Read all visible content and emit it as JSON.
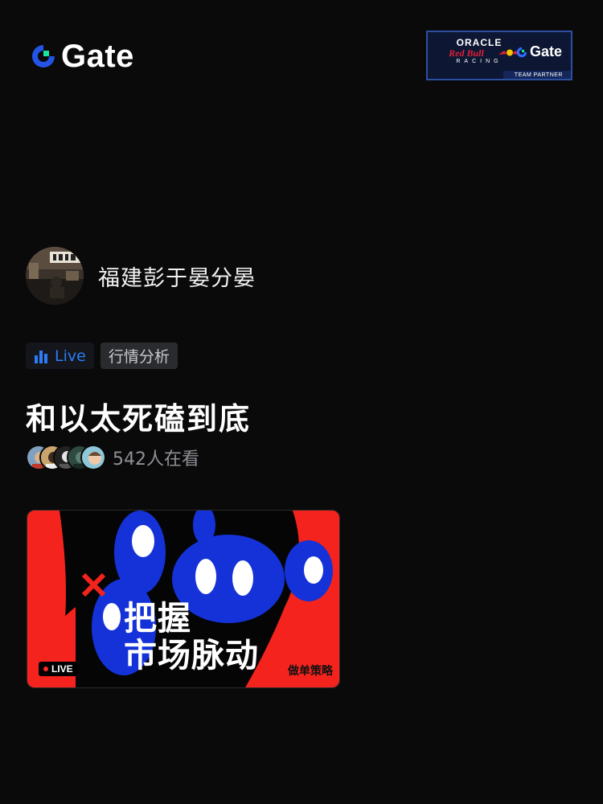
{
  "header": {
    "brand_name": "Gate",
    "brand_icon": "gate-logo-icon",
    "partner": {
      "oracle": "ORACLE",
      "redbull": "Red Bull",
      "racing": "RACING",
      "gate": "Gate",
      "team_partner": "TEAM PARTNER"
    }
  },
  "host": {
    "name": "福建彭于晏分晏",
    "avatar_icon": "host-avatar"
  },
  "tags": {
    "live_label": "Live",
    "topic_label": "行情分析"
  },
  "room": {
    "title": "和以太死磕到底"
  },
  "viewers": {
    "count_text": "542人在看"
  },
  "cover": {
    "headline_line1": "把握",
    "headline_line2": "市场脉动",
    "subtitle": "做单策略",
    "live_badge": "LIVE"
  },
  "colors": {
    "background": "#0a0a0b",
    "brand_blue": "#2354e6",
    "brand_green": "#17e5a2",
    "live_blue": "#2b7cf6",
    "cover_red": "#f5231d",
    "cover_blue": "#1432d8"
  }
}
